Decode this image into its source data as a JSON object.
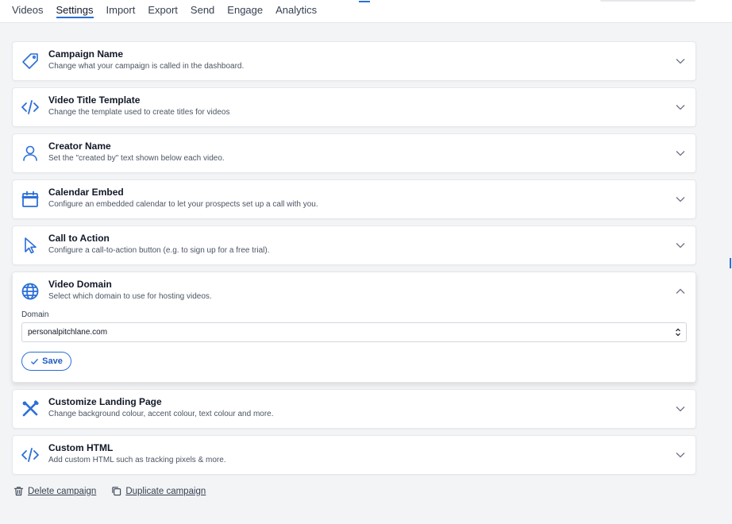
{
  "nav": {
    "tabs": [
      {
        "label": "Videos",
        "active": false
      },
      {
        "label": "Settings",
        "active": true
      },
      {
        "label": "Import",
        "active": false
      },
      {
        "label": "Export",
        "active": false
      },
      {
        "label": "Send",
        "active": false
      },
      {
        "label": "Engage",
        "active": false
      },
      {
        "label": "Analytics",
        "active": false
      }
    ]
  },
  "colors": {
    "accent": "#2b6fd6",
    "page_bg": "#f3f4f6",
    "card_bg": "#ffffff"
  },
  "settings": [
    {
      "icon": "tag-icon",
      "title": "Campaign Name",
      "subtitle": "Change what your campaign is called in the dashboard.",
      "expanded": false
    },
    {
      "icon": "code-icon",
      "title": "Video Title Template",
      "subtitle": "Change the template used to create titles for videos",
      "expanded": false
    },
    {
      "icon": "user-icon",
      "title": "Creator Name",
      "subtitle": "Set the \"created by\" text shown below each video.",
      "expanded": false
    },
    {
      "icon": "calendar-icon",
      "title": "Calendar Embed",
      "subtitle": "Configure an embedded calendar to let your prospects set up a call with you.",
      "expanded": false
    },
    {
      "icon": "cursor-icon",
      "title": "Call to Action",
      "subtitle": "Configure a call-to-action button (e.g. to sign up for a free trial).",
      "expanded": false
    },
    {
      "icon": "globe-icon",
      "title": "Video Domain",
      "subtitle": "Select which domain to use for hosting videos.",
      "expanded": true
    },
    {
      "icon": "tools-icon",
      "title": "Customize Landing Page",
      "subtitle": "Change background colour, accent colour, text colour and more.",
      "expanded": false
    },
    {
      "icon": "code-icon",
      "title": "Custom HTML",
      "subtitle": "Add custom HTML such as tracking pixels & more.",
      "expanded": false
    }
  ],
  "domain_form": {
    "label": "Domain",
    "selected": "personalpitchlane.com",
    "save_label": "Save"
  },
  "footer": {
    "delete_label": "Delete campaign",
    "duplicate_label": "Duplicate campaign"
  }
}
